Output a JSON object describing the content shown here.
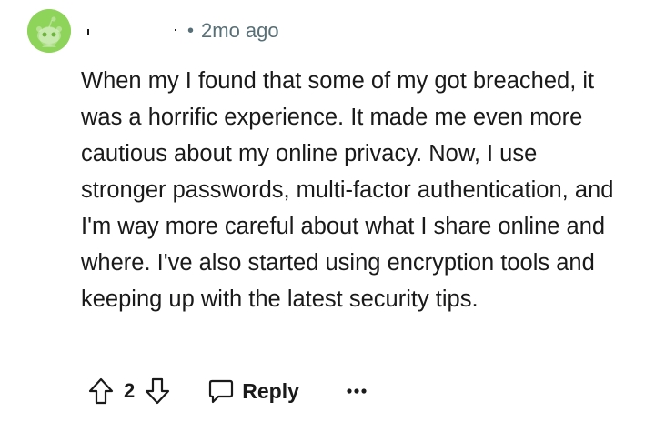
{
  "comment": {
    "avatar_icon": "reddit-snoo-avatar-icon",
    "avatar_color": "#8fd45a",
    "author": "",
    "separator": "•",
    "timestamp": "2mo ago",
    "body": "When my I found that some of my got breached, it was a horrific experience. It made me even more cautious about my online privacy. Now, I use stronger passwords, multi-factor authentication, and I'm way more careful about what I share online and where. I've also started using encryption tools and keeping up with the latest security tips.",
    "score": "2",
    "reply_label": "Reply",
    "more_label": "•••"
  },
  "colors": {
    "text": "#1a1a1b",
    "meta": "#576f76"
  }
}
